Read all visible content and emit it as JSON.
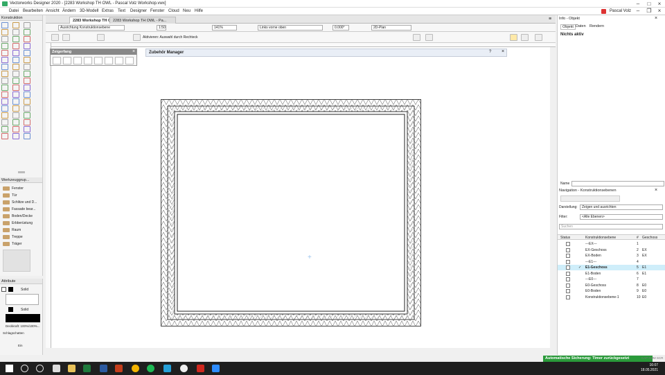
{
  "window": {
    "title": "Vectorworks Designer 2020 - [2283 Workshop TH OWL - Pascal Volz Workshop.vwx]"
  },
  "menu": [
    "Datei",
    "Bearbeiten",
    "Ansicht",
    "Ändern",
    "3D-Modell",
    "Extras",
    "Text",
    "Designer",
    "Fenster",
    "Cloud",
    "Neu",
    "Hilfe"
  ],
  "user": "Pascal Volz",
  "palettes": {
    "konstruktion": "Konstruktion",
    "werkzeuggruppen": "Werkzeuggrup...",
    "werkzeug_items": [
      "Fenster",
      "Tür",
      "Schlitze und D...",
      "Fassade bear...",
      "Boden/Decke",
      "Erbberüstung",
      "Raum",
      "Treppe",
      "Träger"
    ],
    "attribute": "Attribute",
    "attr_fill": "Solid",
    "attr_pen": "Solid",
    "deckkraft": "Deckkraft: 100%/100%...",
    "schlagschatten": "Schlagschatten",
    "zoom_small": "Ein"
  },
  "doc_tabs": [
    "2283 Workshop TH OWL...",
    "2283 Workshop TH OWL - Pa..."
  ],
  "viewbar": {
    "ausrichtung": "Ausrichtung Konstruktionsebene",
    "scale": "1:50",
    "zoom": "141%",
    "view": "Links vorne oben",
    "angle": "0.000°",
    "plan": "2D-Plan"
  },
  "modebar_hint": "Aktivieren: Auswahl durch Rechteck",
  "zeigerfang": "Zeigerfang",
  "zubehoer": "Zubehör Manager",
  "info": {
    "title": "Info - Objekt",
    "tabs": [
      "Objekt",
      "Daten",
      "Rendern"
    ],
    "status": "Nichts aktiv",
    "name_label": "Name"
  },
  "navigation": {
    "title": "Navigation - Konstruktionsebenen",
    "darstellung_label": "Darstellung:",
    "darstellung_value": "Zeigen und ausrichten",
    "filter_label": "Filter:",
    "filter_value": "<Alle Ebenen>",
    "search": "Suchen",
    "headers": [
      "Status",
      "Konstruktionsebene",
      "#",
      "Geschoss"
    ],
    "rows": [
      {
        "name": "---EX---",
        "num": "1",
        "geschoss": "",
        "check": ""
      },
      {
        "name": "EX-Geschoss",
        "num": "2",
        "geschoss": "EX",
        "check": ""
      },
      {
        "name": "EX-Boden",
        "num": "3",
        "geschoss": "EX",
        "check": ""
      },
      {
        "name": "---E1---",
        "num": "4",
        "geschoss": "",
        "check": ""
      },
      {
        "name": "E1-Geschoss",
        "num": "5",
        "geschoss": "E1",
        "check": "✓",
        "selected": true
      },
      {
        "name": "E1-Boden",
        "num": "6",
        "geschoss": "E1",
        "check": ""
      },
      {
        "name": "---E0---",
        "num": "7",
        "geschoss": "",
        "check": ""
      },
      {
        "name": "E0-Geschoss",
        "num": "8",
        "geschoss": "E0",
        "check": ""
      },
      {
        "name": "E0-Boden",
        "num": "9",
        "geschoss": "E0",
        "check": ""
      },
      {
        "name": "Konstruktionsebene-1",
        "num": "10",
        "geschoss": "E0",
        "check": ""
      }
    ]
  },
  "status": {
    "autosave": "Automatische Sicherung: Timer zurückgesetzt",
    "caps": "CAP NUM SCR"
  },
  "clock": {
    "time": "16:07",
    "date": "18.05.2021"
  },
  "colors": {
    "accent": "#2a9a3a",
    "selection": "#cfeefa",
    "taskbar": "#1f1f1f"
  }
}
